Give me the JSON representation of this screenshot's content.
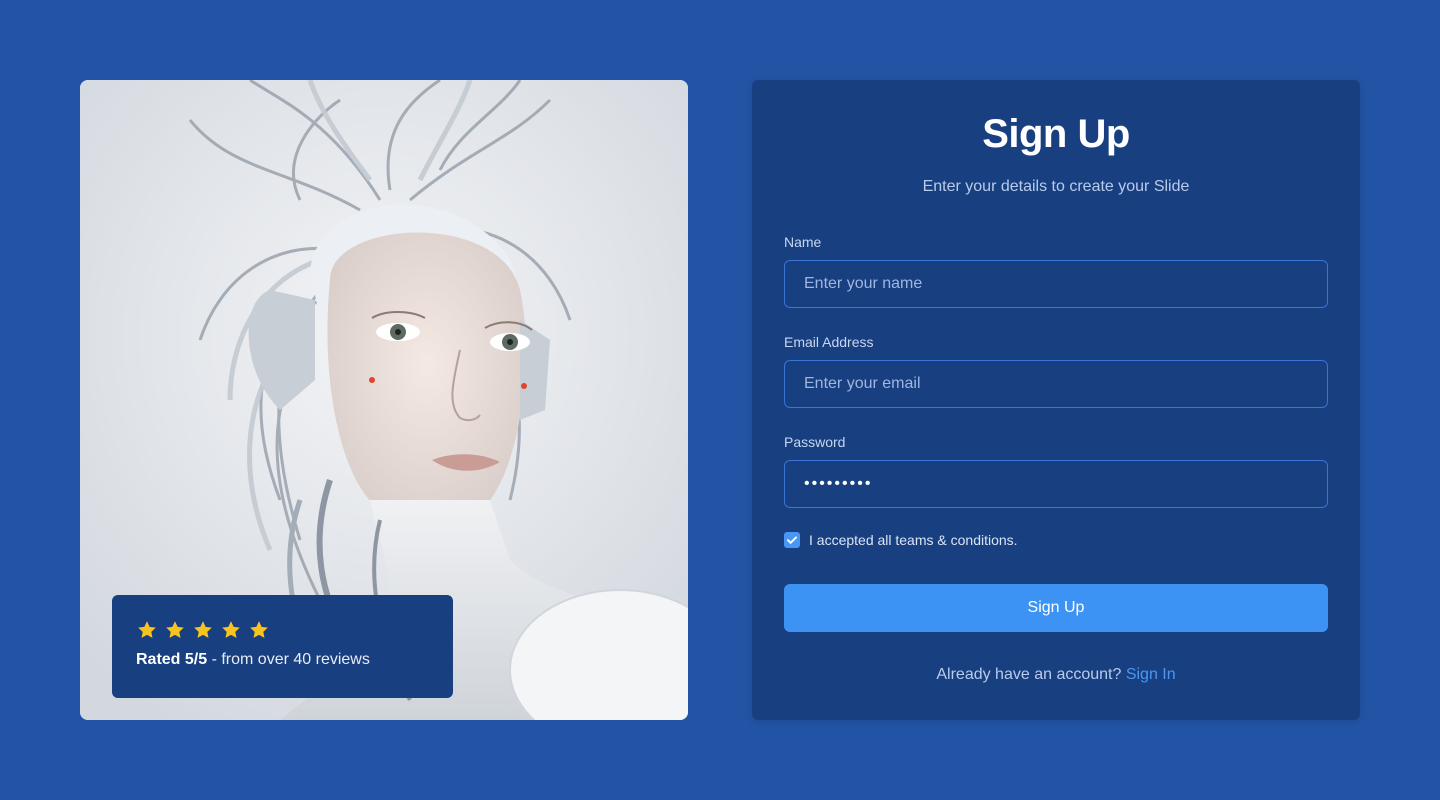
{
  "hero": {
    "image_label": "robot-woman-portrait",
    "rating": {
      "stars": 5,
      "rated_label": "Rated 5/5",
      "reviews_text": " - from over 40 reviews"
    }
  },
  "form": {
    "title": "Sign Up",
    "subtitle": "Enter your details to create your Slide",
    "name": {
      "label": "Name",
      "placeholder": "Enter your name",
      "value": ""
    },
    "email": {
      "label": "Email Address",
      "placeholder": "Enter your email",
      "value": ""
    },
    "password": {
      "label": "Password",
      "value": "123456789"
    },
    "terms": {
      "checked": true,
      "label": "I accepted all teams & conditions."
    },
    "submit_label": "Sign Up",
    "signin_prompt": "Already have an account? ",
    "signin_link": "Sign In"
  },
  "colors": {
    "page_bg": "#2254a6",
    "panel_bg": "#183f80",
    "accent": "#3d93f3",
    "star": "#f7c31f"
  }
}
